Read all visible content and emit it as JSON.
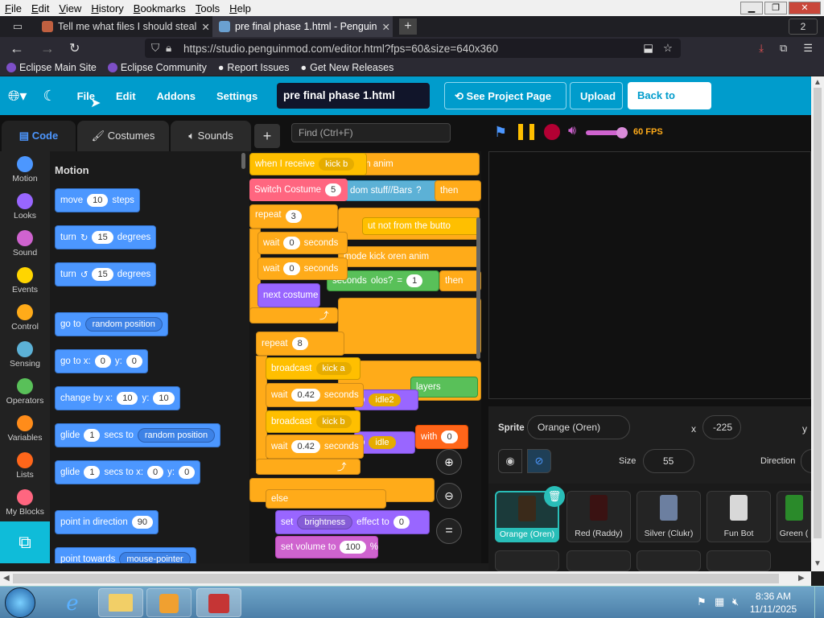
{
  "browser": {
    "menu": [
      "File",
      "Edit",
      "View",
      "History",
      "Bookmarks",
      "Tools",
      "Help"
    ],
    "tabs": [
      {
        "title": "Tell me what files I should steal",
        "close": "✕"
      },
      {
        "title": "pre final phase 1.html - Penguin",
        "close": "✕"
      }
    ],
    "new_tab": "+",
    "tab_count": "2",
    "url": "https://studio.penguinmod.com/editor.html?fps=60&size=640x360",
    "bookmarks": [
      "Eclipse Main Site",
      "Eclipse Community",
      "Report Issues",
      "Get New Releases"
    ]
  },
  "header": {
    "menu": [
      "File",
      "Edit",
      "Addons",
      "Settings"
    ],
    "project_title": "pre final phase 1.html",
    "see_project": "See Project Page",
    "upload": "Upload",
    "back_home": "Back to Home"
  },
  "editor_tabs": {
    "code": "Code",
    "costumes": "Costumes",
    "sounds": "Sounds",
    "find": "Find (Ctrl+F)"
  },
  "categories": [
    {
      "name": "Motion",
      "color": "#4c97ff"
    },
    {
      "name": "Looks",
      "color": "#9966ff"
    },
    {
      "name": "Sound",
      "color": "#cf63cf"
    },
    {
      "name": "Events",
      "color": "#ffd500"
    },
    {
      "name": "Control",
      "color": "#ffab19"
    },
    {
      "name": "Sensing",
      "color": "#5cb1d6"
    },
    {
      "name": "Operators",
      "color": "#59c059"
    },
    {
      "name": "Variables",
      "color": "#ff8c1a"
    },
    {
      "name": "Lists",
      "color": "#ff661a"
    },
    {
      "name": "My Blocks",
      "color": "#ff6680"
    }
  ],
  "palette": {
    "heading": "Motion",
    "move": {
      "a": "move",
      "v": "10",
      "b": "steps"
    },
    "turn_r": {
      "a": "turn",
      "v": "15",
      "b": "degrees"
    },
    "turn_l": {
      "a": "turn",
      "v": "15",
      "b": "degrees"
    },
    "goto": {
      "a": "go to",
      "d": "random position"
    },
    "gotoxy": {
      "a": "go to x:",
      "x": "0",
      "b": "y:",
      "y": "0"
    },
    "change": {
      "a": "change by x:",
      "x": "10",
      "b": "y:",
      "y": "10"
    },
    "glide1": {
      "a": "glide",
      "v": "1",
      "b": "secs to",
      "d": "random position"
    },
    "glide2": {
      "a": "glide",
      "v": "1",
      "b": "secs to x:",
      "x": "0",
      "c": "y:",
      "y": "0"
    },
    "point": {
      "a": "point in direction",
      "v": "90"
    },
    "towards": {
      "a": "point towards",
      "d": "mouse-pointer"
    }
  },
  "script": {
    "when": "when I receive",
    "when_d": "kick b",
    "bg1": "ren anim",
    "bg2": "dom stuff//Bars",
    "bg3": "?",
    "bg4": "then",
    "switch": "Switch Costume",
    "switch_v": "5",
    "repeat1": "repeat",
    "repeat1_v": "3",
    "wait1": "wait",
    "wait1_v": "0",
    "wait1_u": "seconds",
    "wait2": "wait",
    "wait2_v": "0",
    "wait2_u": "seconds",
    "bg5": "ut not from the butto",
    "bg6": "mode kick oren anim",
    "bg7": "seconds",
    "bg8": "olos?",
    "bg9": "=",
    "bg10": "1",
    "bg11": "then",
    "next": "next costume",
    "repeat2": "repeat",
    "repeat2_v": "8",
    "bc1": "broadcast",
    "bc1_d": "kick a",
    "wait3": "wait",
    "wait3_v": "0.42",
    "wait3_u": "seconds",
    "bg12": "o",
    "bg13": "idle2",
    "bg14": "layers",
    "bc2": "broadcast",
    "bc2_d": "kick b",
    "wait4": "wait",
    "wait4_v": "0.42",
    "wait4_u": "seconds",
    "bg15": "o",
    "bg16": "idle",
    "bg17": "with",
    "bg18": "0",
    "else": "else",
    "set": "set",
    "set_d": "brightness",
    "set_b": "effect to",
    "set_v": "0",
    "vol": "set volume to",
    "vol_v": "100",
    "vol_u": "%"
  },
  "stage": {
    "fps": "60 FPS"
  },
  "sprite_info": {
    "sprite_label": "Sprite",
    "sprite_name": "Orange (Oren)",
    "x_label": "x",
    "x": "-225",
    "y_label": "y",
    "size_label": "Size",
    "size": "55",
    "direction_label": "Direction"
  },
  "sprites": [
    {
      "name": "Orange (Oren)",
      "color": "#222"
    },
    {
      "name": "Red (Raddy)",
      "color": "#2a2a2a"
    },
    {
      "name": "Silver (Clukr)",
      "color": "#6c7fa0"
    },
    {
      "name": "Fun Bot",
      "color": "#d8d8d8"
    },
    {
      "name": "Green (",
      "color": "#2a8a2a"
    }
  ],
  "taskbar": {
    "time": "8:36 AM",
    "date": "11/11/2025"
  }
}
